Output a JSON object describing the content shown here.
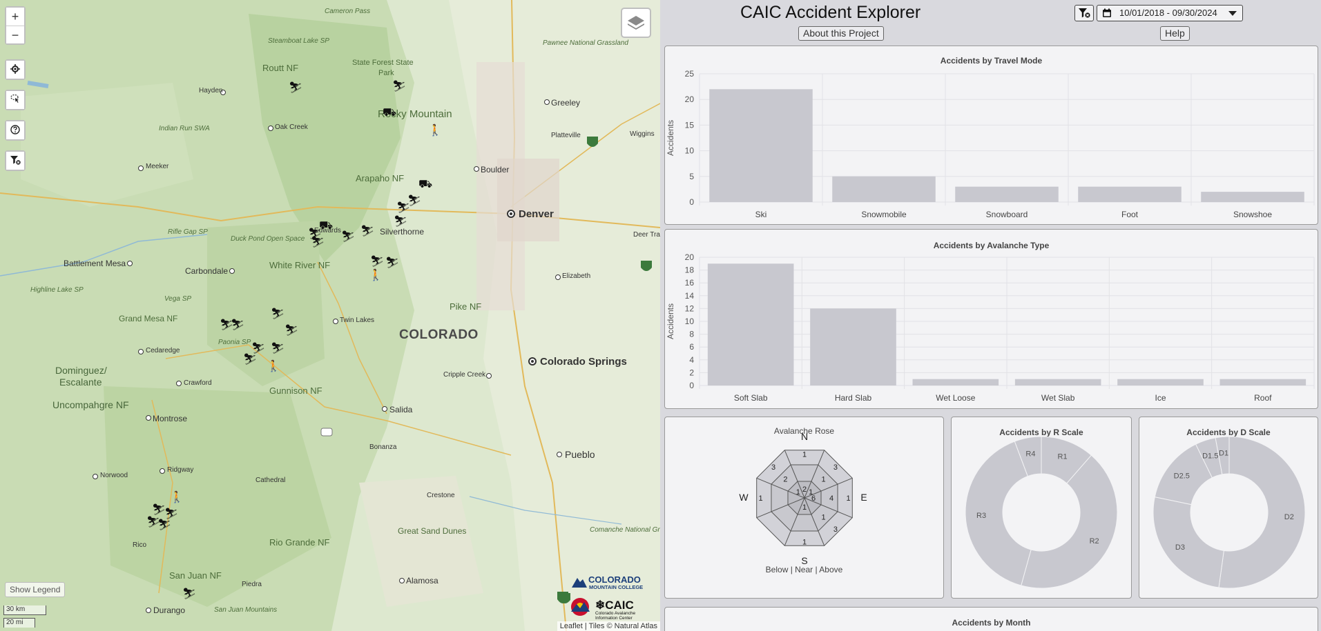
{
  "app": {
    "title": "CAIC Accident Explorer",
    "about_label": "About this Project",
    "help_label": "Help",
    "date_range": "10/01/2018 - 09/30/2024"
  },
  "map": {
    "show_legend_label": "Show Legend",
    "scale_km": "30 km",
    "scale_mi": "20 mi",
    "attribution": "Leaflet | Tiles © Natural Atlas",
    "logo_cmc_line1": "COLORADO",
    "logo_cmc_line2": "MOUNTAIN COLLEGE",
    "logo_caic_main": "CAIC",
    "logo_caic_sub1": "Colorado Avalanche",
    "logo_caic_sub2": "Information Center",
    "cities": [
      {
        "id": "greeley",
        "name": "Greeley"
      },
      {
        "id": "boulder",
        "name": "Boulder"
      },
      {
        "id": "denver",
        "name": "Denver"
      },
      {
        "id": "cosprings",
        "name": "Colorado Springs"
      },
      {
        "id": "pueblo",
        "name": "Pueblo"
      },
      {
        "id": "salida",
        "name": "Salida"
      },
      {
        "id": "montrose",
        "name": "Montrose"
      },
      {
        "id": "durango",
        "name": "Durango"
      },
      {
        "id": "alamosa",
        "name": "Alamosa"
      },
      {
        "id": "carbondale",
        "name": "Carbondale"
      },
      {
        "id": "battlement",
        "name": "Battlement Mesa"
      },
      {
        "id": "silverthorne",
        "name": "Silverthorne"
      },
      {
        "id": "twinlakes",
        "name": "Twin Lakes"
      },
      {
        "id": "crawford",
        "name": "Crawford"
      },
      {
        "id": "cedaredge",
        "name": "Cedaredge"
      },
      {
        "id": "ridgway",
        "name": "Ridgway"
      },
      {
        "id": "norwood",
        "name": "Norwood"
      },
      {
        "id": "hayden",
        "name": "Hayden"
      },
      {
        "id": "oakcreek",
        "name": "Oak Creek"
      },
      {
        "id": "meeker",
        "name": "Meeker"
      },
      {
        "id": "elizabeth",
        "name": "Elizabeth"
      },
      {
        "id": "platteville",
        "name": "Platteville"
      },
      {
        "id": "wiggins",
        "name": "Wiggins"
      },
      {
        "id": "deertrail",
        "name": "Deer Trail"
      },
      {
        "id": "cripple",
        "name": "Cripple Creek"
      },
      {
        "id": "cathedral",
        "name": "Cathedral"
      },
      {
        "id": "crestone",
        "name": "Crestone"
      },
      {
        "id": "bonanza",
        "name": "Bonanza"
      },
      {
        "id": "rico",
        "name": "Rico"
      },
      {
        "id": "piedra",
        "name": "Piedra"
      },
      {
        "id": "edwards",
        "name": "Edwards"
      }
    ],
    "regions": [
      {
        "id": "colorado",
        "name": "COLORADO"
      },
      {
        "id": "rmnp",
        "name": "Rocky Mountain"
      },
      {
        "id": "arapaho",
        "name": "Arapaho NF"
      },
      {
        "id": "routt",
        "name": "Routt NF"
      },
      {
        "id": "whiteriver",
        "name": "White River NF"
      },
      {
        "id": "gunnison",
        "name": "Gunnison NF"
      },
      {
        "id": "riogrande",
        "name": "Rio Grande NF"
      },
      {
        "id": "sanjuan",
        "name": "San Juan NF"
      },
      {
        "id": "pike",
        "name": "Pike NF"
      },
      {
        "id": "grandmesa",
        "name": "Grand Mesa NF"
      },
      {
        "id": "uncompahgre",
        "name": "Uncompahgre NF"
      },
      {
        "id": "dominguez1",
        "name": "Dominguez/"
      },
      {
        "id": "dominguez2",
        "name": "Escalante"
      },
      {
        "id": "statepark1",
        "name": "State Forest State"
      },
      {
        "id": "statepark2",
        "name": "Park"
      },
      {
        "id": "sanddunes",
        "name": "Great Sand Dunes"
      },
      {
        "id": "indianpeaks",
        "name": "Indian Run SWA"
      },
      {
        "id": "rifle",
        "name": "Rifle Gap SP"
      },
      {
        "id": "vega",
        "name": "Vega SP"
      },
      {
        "id": "paonia",
        "name": "Paonia SP"
      },
      {
        "id": "highline",
        "name": "Highline Lake SP"
      },
      {
        "id": "steamboat",
        "name": "Steamboat Lake SP"
      },
      {
        "id": "pawnee",
        "name": "Pawnee National Grassland"
      },
      {
        "id": "cameron",
        "name": "Cameron Pass"
      },
      {
        "id": "duckpond",
        "name": "Duck Pond Open Space"
      },
      {
        "id": "comanche",
        "name": "Comanche National Grassland"
      },
      {
        "id": "sanjuanmt",
        "name": "San Juan Mountains"
      }
    ]
  },
  "charts": {
    "travel_mode": {
      "title": "Accidents by Travel Mode",
      "chart_data": {
        "type": "bar",
        "title": "Accidents by Travel Mode",
        "ylabel": "Accidents",
        "categories": [
          "Ski",
          "Snowmobile",
          "Snowboard",
          "Foot",
          "Snowshoe"
        ],
        "values": [
          22,
          5,
          3,
          3,
          2
        ],
        "ylim": [
          0,
          25
        ],
        "yticks": [
          0,
          5,
          10,
          15,
          20,
          25
        ],
        "color": "#c8c8cf"
      }
    },
    "avalanche_type": {
      "title": "Accidents by Avalanche Type",
      "chart_data": {
        "type": "bar",
        "title": "Accidents by Avalanche Type",
        "ylabel": "Accidents",
        "categories": [
          "Soft Slab",
          "Hard Slab",
          "Wet Loose",
          "Wet Slab",
          "Ice",
          "Roof"
        ],
        "values": [
          19,
          12,
          1,
          1,
          1,
          1
        ],
        "ylim": [
          0,
          20
        ],
        "yticks": [
          0,
          2,
          4,
          6,
          8,
          10,
          12,
          14,
          16,
          18,
          20
        ],
        "color": "#c8c8cf"
      }
    },
    "rose": {
      "title": "Avalanche Rose",
      "legend": "Below | Near | Above",
      "directions": [
        "N",
        "E",
        "S",
        "W"
      ],
      "aspects": [
        "N",
        "NE",
        "E",
        "SE",
        "S",
        "SW",
        "W",
        "NW"
      ],
      "bands": [
        "Below",
        "Near",
        "Above"
      ],
      "counts": {
        "N": [
          2,
          null,
          1
        ],
        "NE": [
          1,
          1,
          3
        ],
        "E": [
          6,
          4,
          1
        ],
        "SE": [
          null,
          1,
          3
        ],
        "S": [
          1,
          null,
          1
        ],
        "SW": [
          null,
          null,
          null
        ],
        "W": [
          null,
          null,
          1
        ],
        "NW": [
          1,
          2,
          3
        ]
      }
    },
    "r_scale": {
      "title": "Accidents by R Scale",
      "chart_data": {
        "type": "pie",
        "title": "Accidents by R Scale",
        "labels": [
          "R1",
          "R2",
          "R3",
          "R4"
        ],
        "values": [
          4,
          15,
          14,
          2
        ],
        "color": "#c8c8cf"
      }
    },
    "d_scale": {
      "title": "Accidents by D Scale",
      "chart_data": {
        "type": "pie",
        "title": "Accidents by D Scale",
        "labels": [
          "D2",
          "D3",
          "D2.5",
          "D1.5",
          "D1"
        ],
        "values": [
          18,
          9,
          5,
          1.5,
          1
        ],
        "color": "#c8c8cf"
      }
    },
    "month": {
      "title": "Accidents by Month"
    }
  }
}
